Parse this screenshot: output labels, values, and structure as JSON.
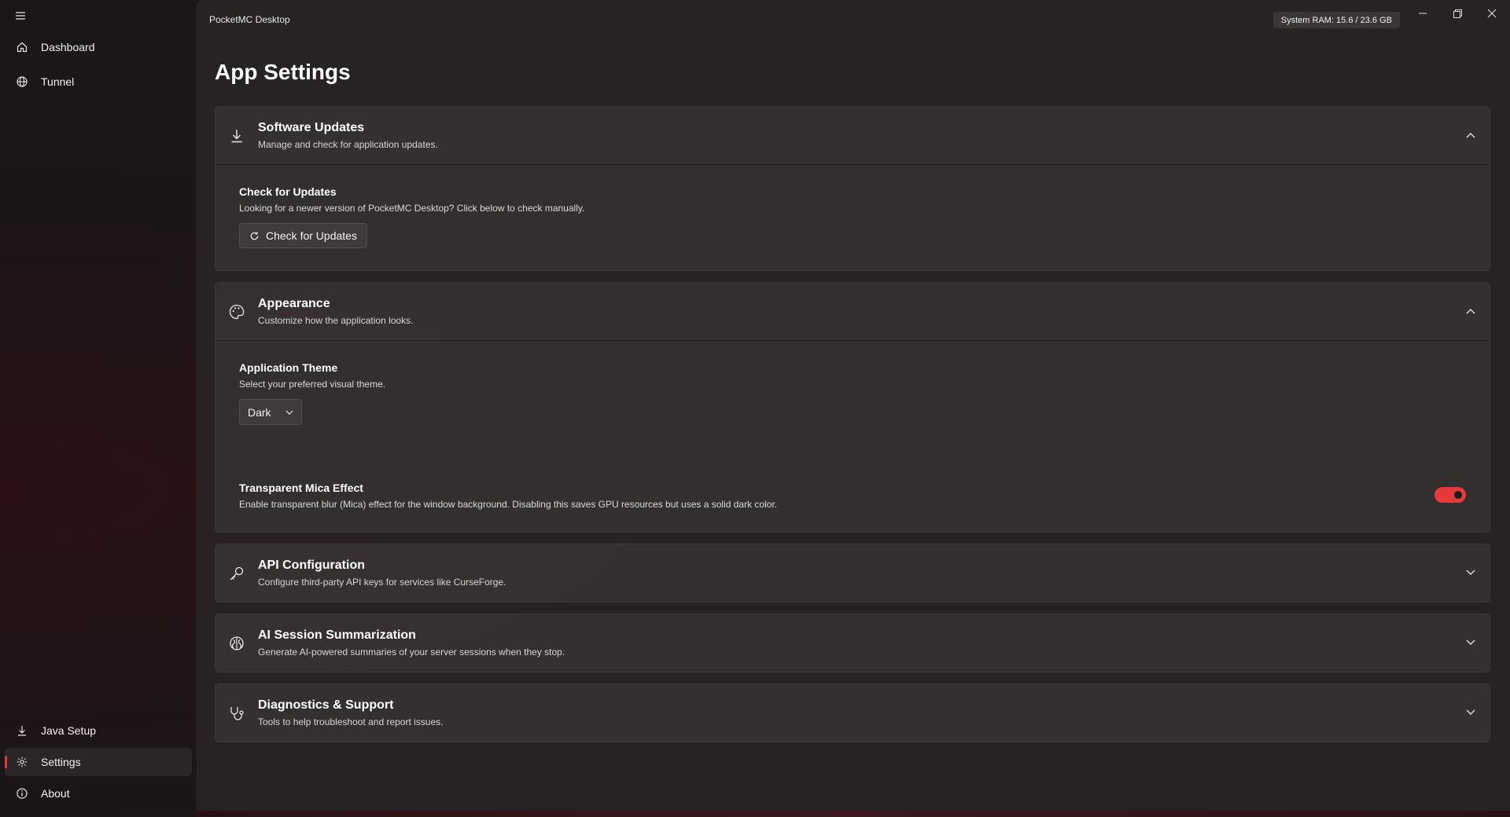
{
  "window": {
    "app_title": "PocketMC Desktop",
    "ram_badge": "System RAM: 15.6 / 23.6 GB"
  },
  "sidebar": {
    "top_items": [
      {
        "label": "Dashboard",
        "icon": "home-icon"
      },
      {
        "label": "Tunnel",
        "icon": "globe-icon"
      }
    ],
    "bottom_items": [
      {
        "label": "Java Setup",
        "icon": "download-icon"
      },
      {
        "label": "Settings",
        "icon": "gear-icon",
        "active": true
      },
      {
        "label": "About",
        "icon": "info-icon"
      }
    ]
  },
  "page": {
    "title": "App Settings"
  },
  "sections": {
    "updates": {
      "title": "Software Updates",
      "subtitle": "Manage and check for application updates.",
      "expanded": true,
      "setting_title": "Check for Updates",
      "setting_sub": "Looking for a newer version of PocketMC Desktop? Click below to check manually.",
      "button_label": "Check for Updates"
    },
    "appearance": {
      "title": "Appearance",
      "subtitle": "Customize how the application looks.",
      "expanded": true,
      "theme_title": "Application Theme",
      "theme_sub": "Select your preferred visual theme.",
      "theme_value": "Dark",
      "mica_title": "Transparent Mica Effect",
      "mica_sub": "Enable transparent blur (Mica) effect for the window background. Disabling this saves GPU resources but uses a solid dark color.",
      "mica_enabled": true
    },
    "api": {
      "title": "API Configuration",
      "subtitle": "Configure third-party API keys for services like CurseForge.",
      "expanded": false
    },
    "ai": {
      "title": "AI Session Summarization",
      "subtitle": "Generate AI-powered summaries of your server sessions when they stop.",
      "expanded": false
    },
    "diagnostics": {
      "title": "Diagnostics & Support",
      "subtitle": "Tools to help troubleshoot and report issues.",
      "expanded": false
    }
  },
  "colors": {
    "accent": "#e5393a",
    "background": "#1c1517"
  }
}
